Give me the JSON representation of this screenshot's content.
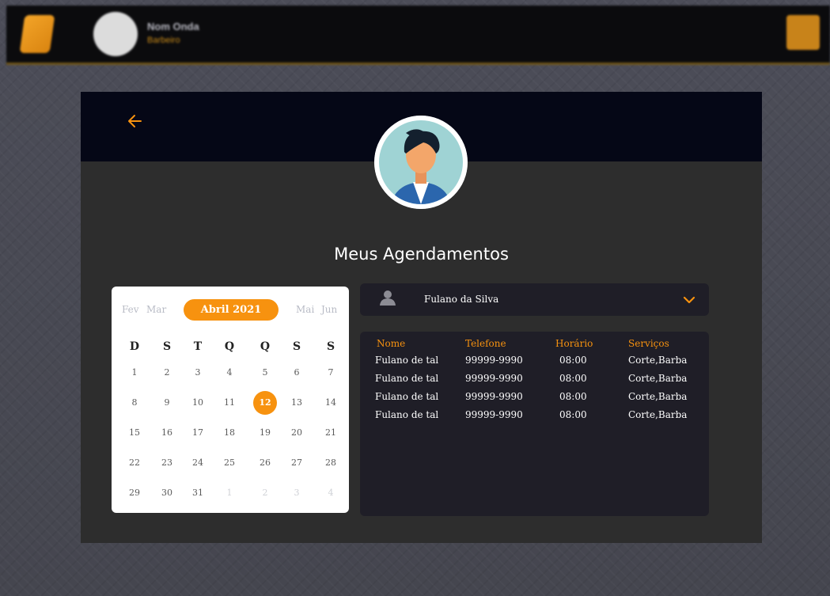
{
  "topbar": {
    "name": "Nom Onda",
    "subtitle": "Barbeiro"
  },
  "colors": {
    "accent": "#f7920f",
    "header_dark": "#050716",
    "panel": "#2d2d2d",
    "card_dark": "#1f1e27"
  },
  "page": {
    "title": "Meus Agendamentos"
  },
  "calendar": {
    "months": {
      "prev2": "Fev",
      "prev1": "Mar",
      "current": "Abril 2021",
      "next1": "Mai",
      "next2": "Jun"
    },
    "weekdays": [
      "D",
      "S",
      "T",
      "Q",
      "Q",
      "S",
      "S"
    ],
    "weeks": [
      [
        "1",
        "2",
        "3",
        "4",
        "5",
        "6",
        "7"
      ],
      [
        "8",
        "9",
        "10",
        "11",
        "12",
        "13",
        "14"
      ],
      [
        "15",
        "16",
        "17",
        "18",
        "19",
        "20",
        "21"
      ],
      [
        "22",
        "23",
        "24",
        "25",
        "26",
        "27",
        "28"
      ],
      [
        "29",
        "30",
        "31",
        "1",
        "2",
        "3",
        "4"
      ]
    ],
    "selected_day": "12"
  },
  "client_select": {
    "value": "Fulano da Silva",
    "icon": "user-icon"
  },
  "appointments": {
    "headers": [
      "Nome",
      "Telefone",
      "Horário",
      "Serviços"
    ],
    "rows": [
      [
        "Fulano de tal",
        "99999-9990",
        "08:00",
        "Corte,Barba"
      ],
      [
        "Fulano de tal",
        "99999-9990",
        "08:00",
        "Corte,Barba"
      ],
      [
        "Fulano de tal",
        "99999-9990",
        "08:00",
        "Corte,Barba"
      ],
      [
        "Fulano de tal",
        "99999-9990",
        "08:00",
        "Corte,Barba"
      ]
    ]
  }
}
